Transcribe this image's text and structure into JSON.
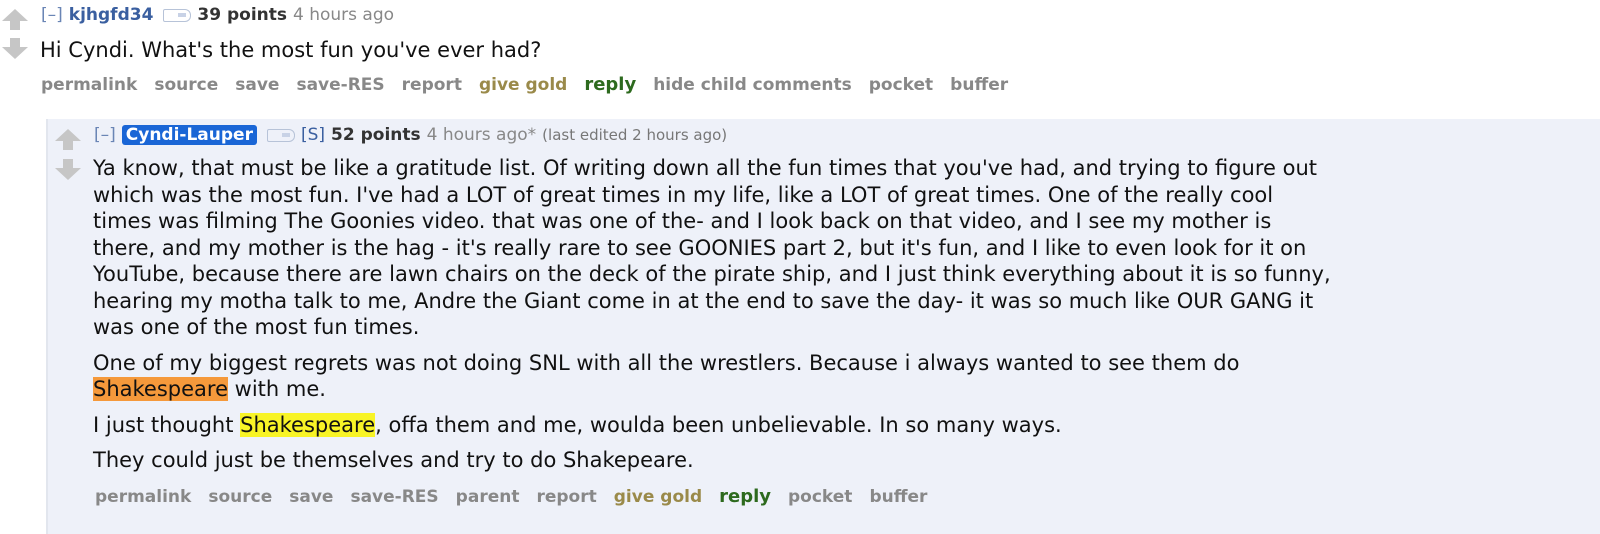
{
  "parent": {
    "expand": "[–]",
    "author": "kjhgfd34",
    "score": "39 points",
    "time": "4 hours ago",
    "body": "Hi Cyndi. What's the most fun you've ever had?",
    "buttons": {
      "permalink": "permalink",
      "source": "source",
      "save": "save",
      "save_res": "save-RES",
      "report": "report",
      "give_gold": "give gold",
      "reply": "reply",
      "hide_child": "hide child comments",
      "pocket": "pocket",
      "buffer": "buffer"
    }
  },
  "child": {
    "expand": "[–]",
    "author": "Cyndi-Lauper",
    "submitter": "[S]",
    "score": "52 points",
    "time": "4 hours ago*",
    "edited": "(last edited 2 hours ago)",
    "p1_lines": [
      "Ya know, that must be like a gratitude list. Of writing down all the fun times that you've had, and trying to figure out",
      "which was the most fun. I've had a LOT of great times in my life, like a LOT of great times. One of the really cool",
      "times was filming The Goonies video. that was one of the- and I look back on that video, and I see my mother is",
      "there, and my mother is the hag - it's really rare to see GOONIES part 2, but it's fun, and I like to even look for it on",
      "YouTube, because there are lawn chairs on the deck of the pirate ship, and I just think everything about it is so funny,",
      "hearing my motha talk to me, Andre the Giant come in at the end to save the day- it was so much like OUR GANG it",
      "was one of the most fun times."
    ],
    "p2_line1": "One of my biggest regrets was not doing SNL with all the wrestlers. Because i always wanted to see them do",
    "p2_highlight": "Shakespeare",
    "p2_rest": " with me.",
    "p3_pre": "I just thought ",
    "p3_highlight": "Shakespeare",
    "p3_rest": ", offa them and me, woulda been unbelievable. In so many ways.",
    "p4": "They could just be themselves and try to do Shakepeare.",
    "buttons": {
      "permalink": "permalink",
      "source": "source",
      "save": "save",
      "save_res": "save-RES",
      "parent": "parent",
      "report": "report",
      "give_gold": "give gold",
      "reply": "reply",
      "pocket": "pocket",
      "buffer": "buffer"
    }
  }
}
